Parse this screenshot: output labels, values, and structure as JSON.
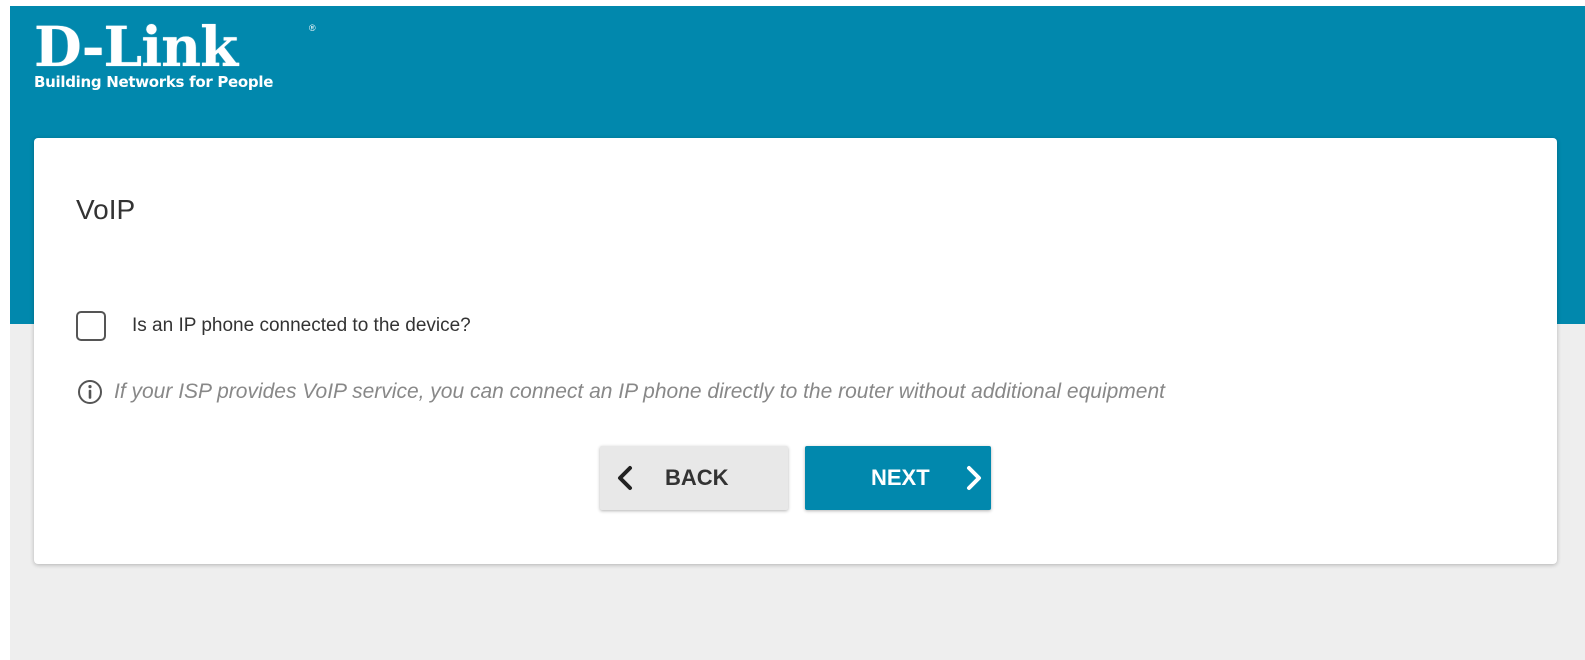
{
  "brand": {
    "name": "D-Link",
    "registered": "®",
    "tagline": "Building Networks for People"
  },
  "card": {
    "title": "VoIP",
    "checkbox": {
      "label": "Is an IP phone connected to the device?",
      "checked": false
    },
    "hint": {
      "icon": "info-icon",
      "text": "If your ISP provides VoIP service, you can connect an IP phone directly to the router without additional equipment"
    }
  },
  "buttons": {
    "back": {
      "label": "BACK",
      "icon": "chevron-left-icon"
    },
    "next": {
      "label": "NEXT",
      "icon": "chevron-right-icon"
    }
  },
  "colors": {
    "brand_teal": "#0188ad",
    "page_background": "#eeeeee",
    "card_background": "#ffffff",
    "hint_text": "#888888",
    "back_button": "#e8e8e8"
  }
}
